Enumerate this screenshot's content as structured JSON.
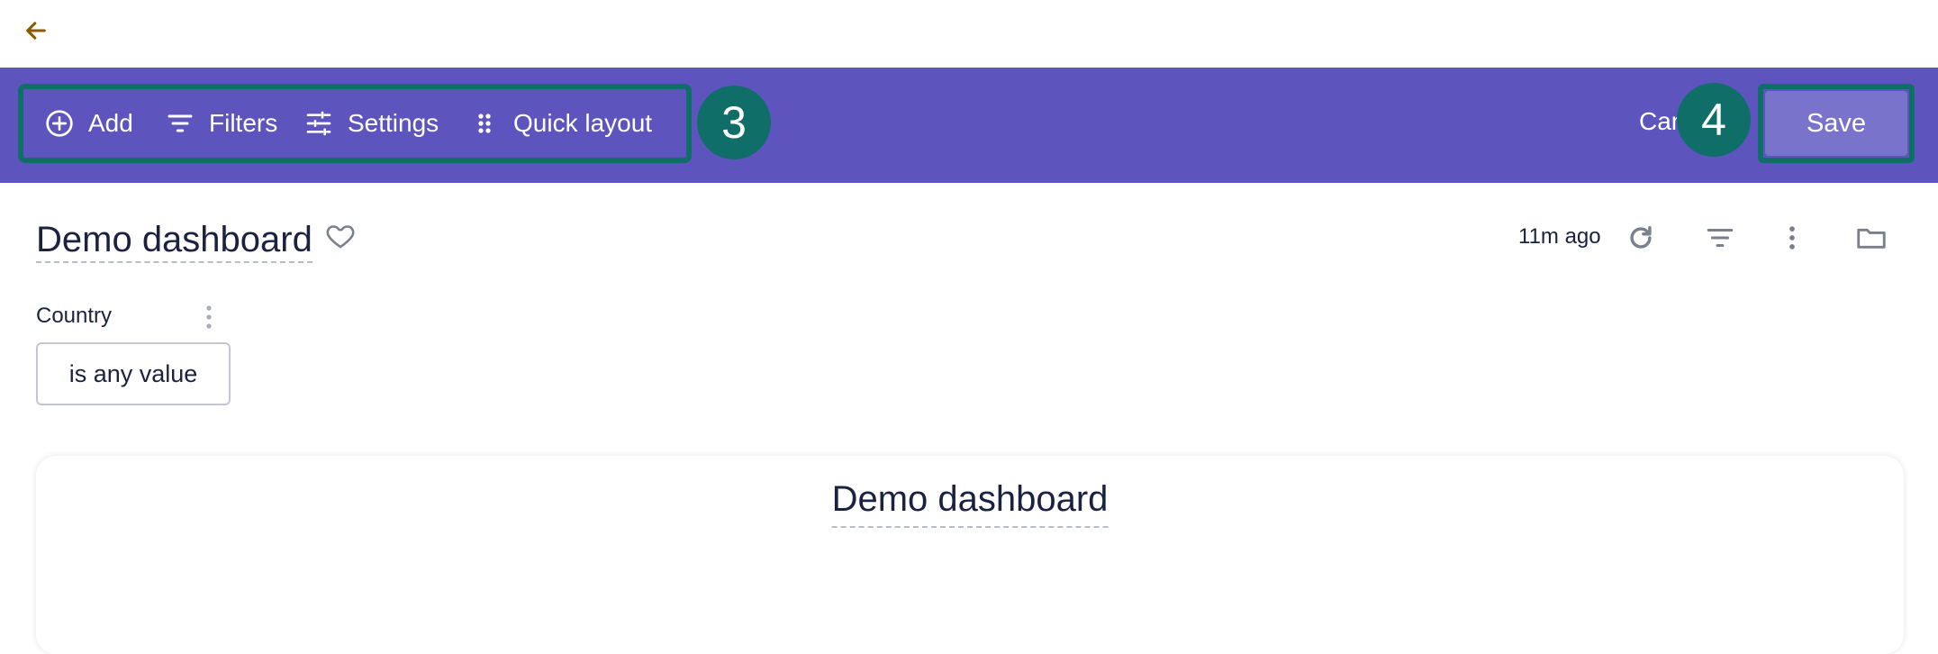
{
  "toolbar": {
    "add_label": "Add",
    "filters_label": "Filters",
    "settings_label": "Settings",
    "quick_layout_label": "Quick layout",
    "cancel_label": "Cancel",
    "save_label": "Save",
    "badges": [
      "3",
      "4"
    ]
  },
  "dashboard": {
    "title": "Demo dashboard",
    "updated": "11m ago"
  },
  "filter": {
    "label": "Country",
    "value": "is any value"
  },
  "tile": {
    "title": "Demo dashboard"
  },
  "colors": {
    "toolbar_bg": "#5d55bd",
    "highlight": "#0f6e68",
    "save_bg": "#7a73cc",
    "back_arrow": "#8a5a00",
    "text": "#1a2240"
  }
}
